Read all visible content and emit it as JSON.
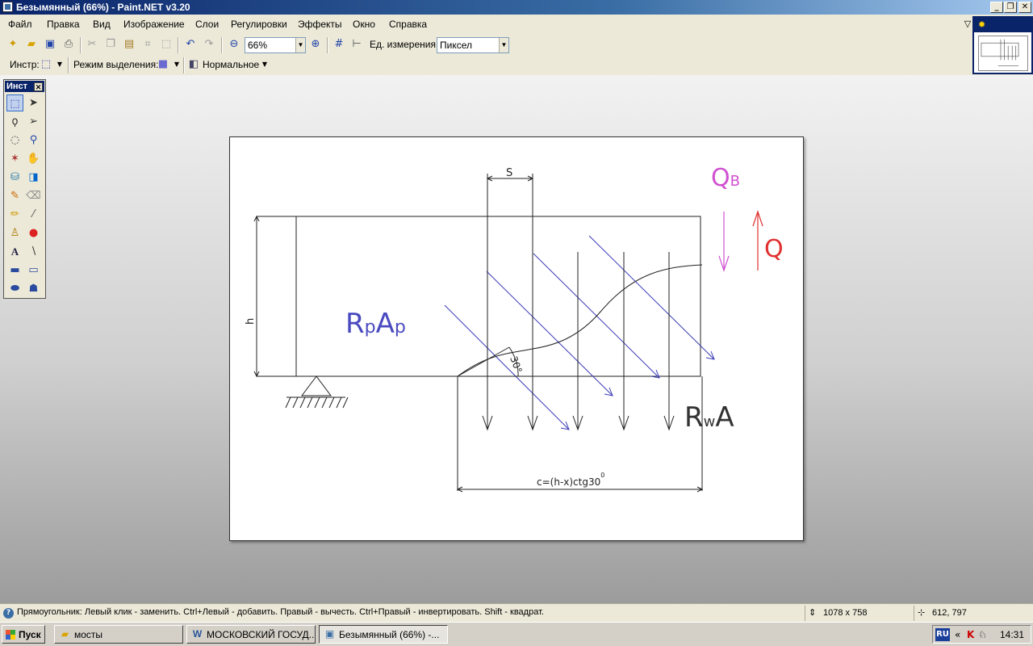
{
  "window": {
    "title": "Безымянный (66%) - Paint.NET v3.20",
    "minimize": "_",
    "restore": "❐",
    "close": "✕"
  },
  "menu": [
    "Файл",
    "Правка",
    "Вид",
    "Изображение",
    "Слои",
    "Регулировки",
    "Эффекты",
    "Окно",
    "Справка"
  ],
  "toolbar": {
    "zoom_value": "66%",
    "units_label": "Ед. измерения:",
    "units_value": "Пиксел",
    "tool_label": "Инстр:",
    "selection_mode_label": "Режим выделения:",
    "blend_mode": "Нормальное"
  },
  "tools_window": {
    "title": "Инст",
    "close": "✕"
  },
  "drawing": {
    "label_s": "S",
    "label_qb_q": "Q",
    "label_qb_sub": "В",
    "label_q": "Q",
    "label_h": "h",
    "label_rpap_r": "R",
    "label_rpap_p1": "p",
    "label_rpap_a": "A",
    "label_rpap_p2": "p",
    "label_rwa_r": "R",
    "label_rwa_w": "w",
    "label_rwa_a": "A",
    "label_angle": "30°",
    "label_c": "c=(h-x)ctg30",
    "label_c_sup": "0",
    "colors": {
      "qb": "#d050d0",
      "q": "#e03030",
      "hatch": "#3a3ab8",
      "text_blue": "#4a4ac0"
    }
  },
  "status": {
    "hint": "Прямоугольник: Левый клик - заменить. Ctrl+Левый - добавить. Правый - вычесть. Ctrl+Правый - инвертировать. Shift - квадрат.",
    "image_size": "1078 x 758",
    "cursor_pos": "612, 797"
  },
  "taskbar": {
    "start": "Пуск",
    "tasks": [
      {
        "label": "мосты",
        "icon": "folder-icon"
      },
      {
        "label": "МОСКОВСКИЙ ГОСУД...",
        "icon": "word-icon"
      },
      {
        "label": "Безымянный (66%) -...",
        "icon": "paintnet-icon"
      }
    ],
    "lang": "RU",
    "clock": "14:31"
  }
}
